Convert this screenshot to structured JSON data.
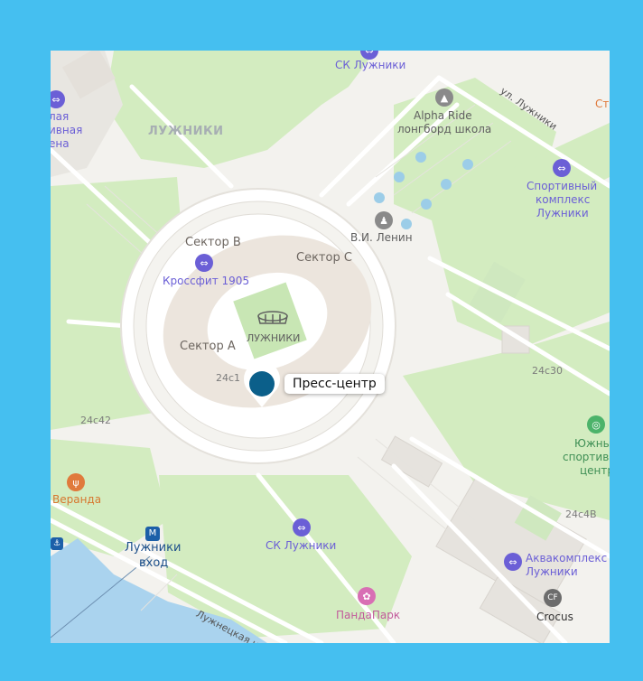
{
  "map": {
    "labels": {
      "sk_luzhniki_top": "СК Лужники",
      "sk_luzhniki_bottom": "СК Лужники",
      "alpha_ride": "Alpha Ride",
      "alpha_ride_sub": "лонгборд школа",
      "street_luzhniki": "ул. Лужники",
      "st_cut": "Ст",
      "big_left_1": "лая",
      "big_left_2": "ивная",
      "big_left_3": "ена",
      "area_luzhniki": "ЛУЖНИКИ",
      "sport_complex_1": "Спортивный",
      "sport_complex_2": "комплекс",
      "sport_complex_3": "Лужники",
      "lenin": "В.И. Ленин",
      "sector_b": "Сектор B",
      "sector_c": "Сектор C",
      "sector_a": "Сектор A",
      "crossfit": "Кроссфит 1905",
      "stadium": "ЛУЖНИКИ",
      "bldg_24c1": "24с1",
      "bldg_24c30": "24с30",
      "bldg_24c42": "24с42",
      "bldg_24c4b": "24с4В",
      "south_1": "Южны",
      "south_2": "спортив",
      "south_3": "центр",
      "veranda": "Веранда",
      "metro_1": "Лужники",
      "metro_2": "вход",
      "aqua_1": "Аквакомплекс",
      "aqua_2": "Лужники",
      "crocus": "Crocus",
      "crocus_badge": "CF",
      "pandapark": "ПандаПарк",
      "luzhnetskaya": "Лужнецкая на"
    },
    "marker": {
      "label": "Пресс-центр",
      "color": "#0b5f8a"
    },
    "colors": {
      "frame": "#45bff0",
      "green": "#d3ecc0",
      "road": "#ffffff",
      "water": "#aad3ee",
      "poi": "#6b5fd6",
      "stadium_ring": "#ece5dd",
      "pitch": "#c8e6b4"
    }
  }
}
